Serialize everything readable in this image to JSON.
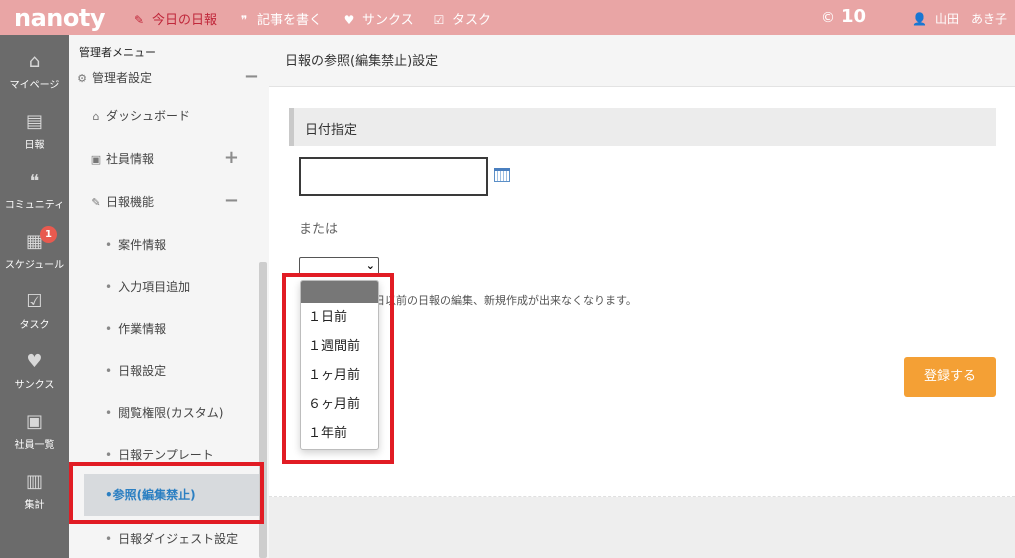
{
  "header": {
    "logo": "nanoty",
    "nav": [
      {
        "icon": "pencil-note-icon",
        "label": "今日の日報",
        "active": true
      },
      {
        "icon": "chat-bubble-icon",
        "label": "記事を書く",
        "active": false
      },
      {
        "icon": "heart-icon",
        "label": "サンクス",
        "active": false
      },
      {
        "icon": "clipboard-check-icon",
        "label": "タスク",
        "active": false
      }
    ],
    "points": "10",
    "user_name": "山田　あき子"
  },
  "rail": [
    {
      "icon": "home-icon",
      "label": "マイページ"
    },
    {
      "icon": "report-icon",
      "label": "日報"
    },
    {
      "icon": "community-icon",
      "label": "コミュニティ"
    },
    {
      "icon": "calendar-icon",
      "label": "スケジュール",
      "badge": "1"
    },
    {
      "icon": "task-icon",
      "label": "タスク"
    },
    {
      "icon": "heart-icon",
      "label": "サンクス"
    },
    {
      "icon": "directory-icon",
      "label": "社員一覧"
    },
    {
      "icon": "bar-chart-icon",
      "label": "集計"
    }
  ],
  "side": {
    "title": "管理者メニュー",
    "admin_settings": "管理者設定",
    "dashboard": "ダッシュボード",
    "employee_info": "社員情報",
    "report_functions": "日報機能",
    "sub_items": [
      "案件情報",
      "入力項目追加",
      "作業情報",
      "日報設定",
      "閲覧権限(カスタム)",
      "日報テンプレート",
      "参照(編集禁止)",
      "日報ダイジェスト設定"
    ]
  },
  "main": {
    "title": "日報の参照(編集禁止)設定",
    "section_title": "日付指定",
    "or_label": "または",
    "note": "日以前の日報の編集、新規作成が出来なくなります。",
    "register_button": "登録する",
    "date_value": "",
    "select_value": ""
  },
  "dropdown": {
    "options": [
      "",
      "１日前",
      "１週間前",
      "１ヶ月前",
      "６ヶ月前",
      "１年前"
    ]
  },
  "colors": {
    "topbar": "#e9a5a5",
    "active_nav": "#c0283b",
    "rail": "#6b6b6b",
    "accent_button": "#f4a035",
    "highlight_box": "#e11c24",
    "selected_link": "#2b7fc2"
  }
}
